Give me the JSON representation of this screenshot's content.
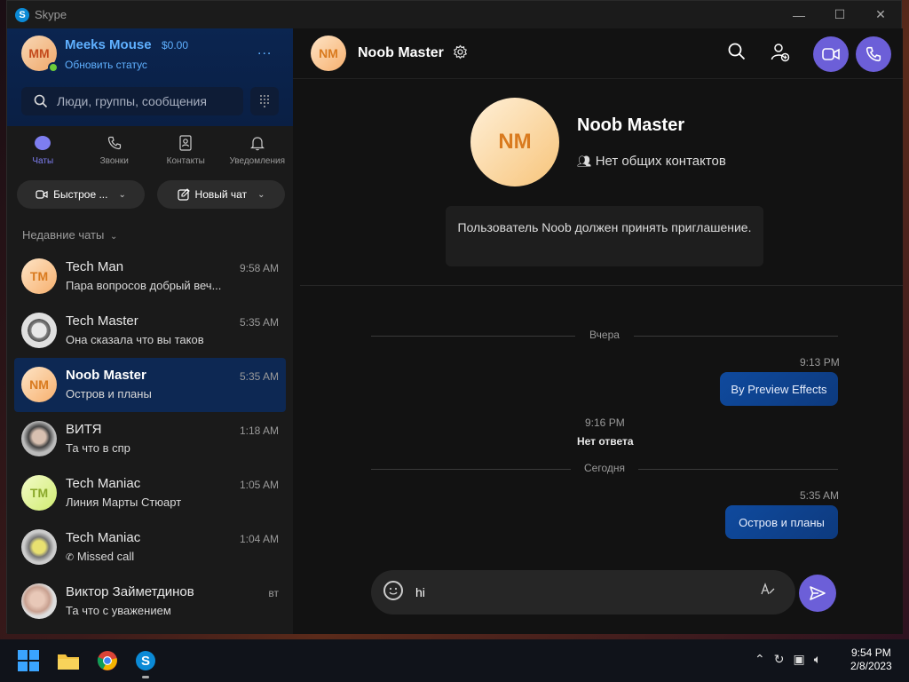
{
  "window": {
    "title": "Skype"
  },
  "profile": {
    "initials": "MM",
    "name": "Meeks Mouse",
    "balance": "$0.00",
    "status_link": "Обновить статус",
    "more": "..."
  },
  "search": {
    "placeholder": "Люди, группы, сообщения"
  },
  "nav": [
    {
      "label": "Чаты",
      "icon": "chat-icon"
    },
    {
      "label": "Звонки",
      "icon": "phone-icon"
    },
    {
      "label": "Контакты",
      "icon": "contacts-icon"
    },
    {
      "label": "Уведомления",
      "icon": "bell-icon"
    }
  ],
  "quick": {
    "call_label": "Быстрое ...",
    "new_chat_label": "Новый чат"
  },
  "recent": {
    "header": "Недавние чаты"
  },
  "chats": [
    {
      "initials": "TM",
      "name": "Tech Man",
      "message": "Пара вопросов добрый веч...",
      "time": "9:58 AM",
      "avatar": "orange"
    },
    {
      "initials": "",
      "name": "Tech Master",
      "message": "Она сказала что вы таков",
      "time": "5:35 AM",
      "avatar": "photo"
    },
    {
      "initials": "NM",
      "name": "Noob Master",
      "message": "Остров и планы",
      "time": "5:35 AM",
      "avatar": "orange"
    },
    {
      "initials": "",
      "name": "ВИТЯ",
      "message": "Та что в спр",
      "time": "1:18 AM",
      "avatar": "photo"
    },
    {
      "initials": "TM",
      "name": "Tech Maniac",
      "message": "Линия Марты Стюарт",
      "time": "1:05 AM",
      "avatar": "lime"
    },
    {
      "initials": "",
      "name": "Tech Maniac",
      "message": "Missed call",
      "time": "1:04 AM",
      "avatar": "photo"
    },
    {
      "initials": "",
      "name": "Виктор Займетдинов",
      "message": "Та что с уважением",
      "time": "вт",
      "avatar": "photo"
    }
  ],
  "conversation": {
    "initials": "NM",
    "name": "Noob Master",
    "common_contacts": "Нет общих контактов",
    "invite_text": "Пользователь Noob должен принять приглашение.",
    "day1": "Вчера",
    "msg1_time": "9:13 PM",
    "msg1_text": "By Preview Effects",
    "call_time": "9:16 PM",
    "call_text": "Нет ответа",
    "day2": "Сегодня",
    "msg2_time": "5:35 AM",
    "msg2_text": "Остров и планы"
  },
  "composer": {
    "value": "hi"
  },
  "taskbar": {
    "time": "9:54 PM",
    "date": "2/8/2023"
  },
  "colors": {
    "accent": "#6c5fd8",
    "bubble": "#0f4a9e",
    "link": "#5fb0ff"
  }
}
